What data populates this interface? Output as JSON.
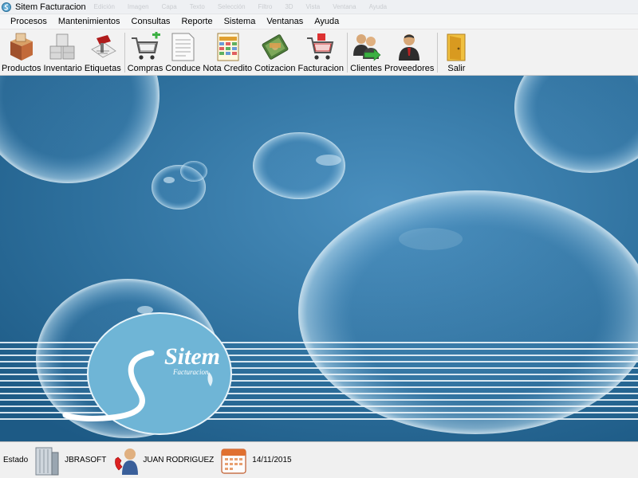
{
  "window": {
    "title": "Sitem Facturacion"
  },
  "ghost_menu": [
    "Edición",
    "Imagen",
    "Capa",
    "Texto",
    "Selección",
    "Filtro",
    "3D",
    "Vista",
    "Ventana",
    "Ayuda"
  ],
  "menu": {
    "procesos": "Procesos",
    "mantenimientos": "Mantenimientos",
    "consultas": "Consultas",
    "reporte": "Reporte",
    "sistema": "Sistema",
    "ventanas": "Ventanas",
    "ayuda": "Ayuda"
  },
  "toolbar": {
    "productos": "Productos",
    "inventario": "Inventario",
    "etiquetas": "Etiquetas",
    "compras": "Compras",
    "conduce": "Conduce",
    "nota_credito": "Nota Credito",
    "cotizacion": "Cotizacion",
    "facturacion": "Facturacion",
    "clientes": "Clientes",
    "proveedores": "Proveedores",
    "salir": "Salir"
  },
  "logo": {
    "brand": "Sitem",
    "tagline": "Facturacion"
  },
  "status": {
    "estado": "Estado",
    "company": "JBRASOFT",
    "user": "JUAN RODRIGUEZ",
    "date": "14/11/2015"
  },
  "colors": {
    "desktop_bg": "#2d6f9c",
    "logo_fill": "#6fb5d6",
    "accent_green": "#3cb043"
  }
}
